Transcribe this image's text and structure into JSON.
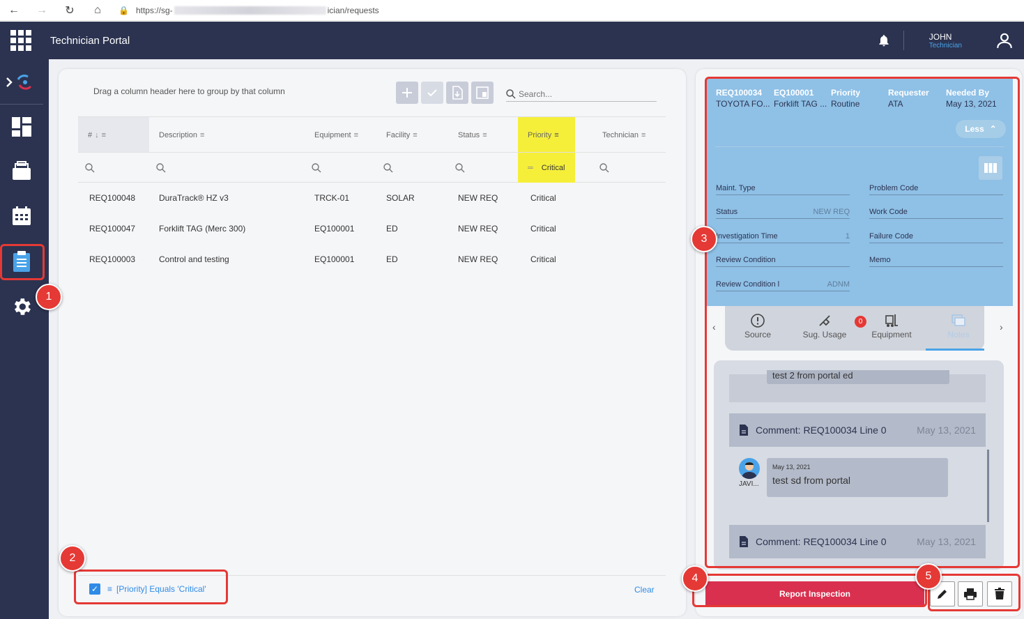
{
  "browser": {
    "url_prefix": "https://sg-",
    "url_suffix": "ician/requests"
  },
  "header": {
    "title": "Technician Portal",
    "user_name": "JOHN",
    "user_role": "Technician"
  },
  "callouts": [
    "1",
    "2",
    "3",
    "4",
    "5"
  ],
  "grid": {
    "group_hint": "Drag a column header here to group by that column",
    "search_placeholder": "Search...",
    "columns": [
      "#",
      "Description",
      "Equipment",
      "Facility",
      "Status",
      "Priority",
      "Technician"
    ],
    "priority_filter_value": "Critical",
    "rows": [
      {
        "id": "REQ100048",
        "description": "DuraTrack® HZ v3",
        "equipment": "TRCK-01",
        "facility": "SOLAR",
        "status": "NEW REQ",
        "priority": "Critical",
        "technician": ""
      },
      {
        "id": "REQ100047",
        "description": "Forklift TAG (Merc 300)",
        "equipment": "EQ100001",
        "facility": "ED",
        "status": "NEW REQ",
        "priority": "Critical",
        "technician": ""
      },
      {
        "id": "REQ100003",
        "description": "Control and testing",
        "equipment": "EQ100001",
        "facility": "ED",
        "status": "NEW REQ",
        "priority": "Critical",
        "technician": ""
      }
    ],
    "filter_chip": "[Priority] Equals 'Critical'",
    "clear_label": "Clear"
  },
  "detail": {
    "header_fields": [
      {
        "key": "REQ100034",
        "value": "TOYOTA FO..."
      },
      {
        "key": "EQ100001",
        "value": "Forklift TAG ..."
      },
      {
        "key": "Priority",
        "value": "Routine"
      },
      {
        "key": "Requester",
        "value": "ATA"
      },
      {
        "key": "Needed By",
        "value": "May 13, 2021"
      }
    ],
    "less_label": "Less",
    "left_fields": [
      {
        "label": "Maint. Type",
        "value": ""
      },
      {
        "label": "Status",
        "value": "NEW REQ"
      },
      {
        "label": "Investigation Time",
        "value": "1"
      },
      {
        "label": "Review Condition",
        "value": ""
      },
      {
        "label": "Review Condition l",
        "value": "ADNM"
      }
    ],
    "right_fields": [
      {
        "label": "Problem Code",
        "value": ""
      },
      {
        "label": "Work Code",
        "value": ""
      },
      {
        "label": "Failure Code",
        "value": ""
      },
      {
        "label": "Memo",
        "value": ""
      }
    ],
    "tabs": [
      "Source",
      "Sug. Usage",
      "Equipment",
      "Notes"
    ],
    "sug_usage_badge": "0",
    "notes": {
      "top_partial_text": "test 2 from portal ed",
      "comment1_title": "Comment: REQ100034 Line 0",
      "comment1_date": "May 13, 2021",
      "bubble_date": "May 13, 2021",
      "bubble_text": "test sd from portal",
      "author": "JAVI...",
      "comment2_title": "Comment: REQ100034 Line 0",
      "comment2_date": "May 13, 2021"
    },
    "report_label": "Report Inspection"
  },
  "colors": {
    "header_bg": "#2b3350",
    "accent_blue": "#4aa3e8",
    "highlight_yellow": "#f6ef3a",
    "callout_red": "#e53935",
    "report_red": "#d9304f",
    "detail_blue": "#8fc0e6"
  },
  "icons": [
    "back-icon",
    "forward-icon",
    "reload-icon",
    "home-icon",
    "lock-icon",
    "apps-grid-icon",
    "bell-icon",
    "user-icon",
    "logo-icon",
    "dashboard-icon",
    "inbox-icon",
    "calendar-icon",
    "clipboard-icon",
    "gear-icon",
    "add-icon",
    "check-icon",
    "export-icon",
    "layout-icon",
    "search-icon",
    "filter-icon",
    "columns-icon",
    "edit-icon",
    "print-icon",
    "trash-icon"
  ]
}
